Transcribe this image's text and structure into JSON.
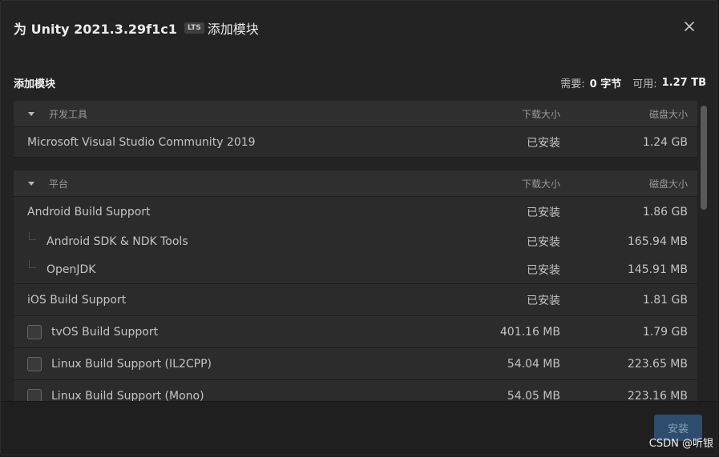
{
  "header": {
    "title_prefix": "为 Unity 2021.3.29f1c1",
    "lts_badge": "LTS",
    "title_suffix": "添加模块"
  },
  "subheader": {
    "left_label": "添加模块",
    "required_label": "需要:",
    "required_value": "0 字节",
    "available_label": "可用:",
    "available_value": "1.27 TB"
  },
  "sections": [
    {
      "name": "开发工具",
      "col_download": "下载大小",
      "col_disk": "磁盘大小",
      "rows": [
        {
          "name": "Microsoft Visual Studio Community 2019",
          "download": "已安装",
          "disk": "1.24 GB"
        }
      ]
    },
    {
      "name": "平台",
      "col_download": "下载大小",
      "col_disk": "磁盘大小",
      "rows": [
        {
          "name": "Android Build Support",
          "download": "已安装",
          "disk": "1.86 GB"
        },
        {
          "name": "Android SDK & NDK Tools",
          "download": "已安装",
          "disk": "165.94 MB"
        },
        {
          "name": "OpenJDK",
          "download": "已安装",
          "disk": "145.91 MB"
        },
        {
          "name": "iOS Build Support",
          "download": "已安装",
          "disk": "1.81 GB"
        },
        {
          "name": "tvOS Build Support",
          "download": "401.16 MB",
          "disk": "1.79 GB"
        },
        {
          "name": "Linux Build Support (IL2CPP)",
          "download": "54.04 MB",
          "disk": "223.65 MB"
        },
        {
          "name": "Linux Build Support (Mono)",
          "download": "54.05 MB",
          "disk": "223.16 MB"
        }
      ]
    }
  ],
  "footer": {
    "install_label": "安装",
    "watermark": "CSDN @听银"
  },
  "icons": {
    "close": "close-icon",
    "caret": "chevron-down-icon"
  },
  "colors": {
    "background": "#232323",
    "row": "#2b2b2b",
    "accent_button": "#2e4d6e"
  }
}
